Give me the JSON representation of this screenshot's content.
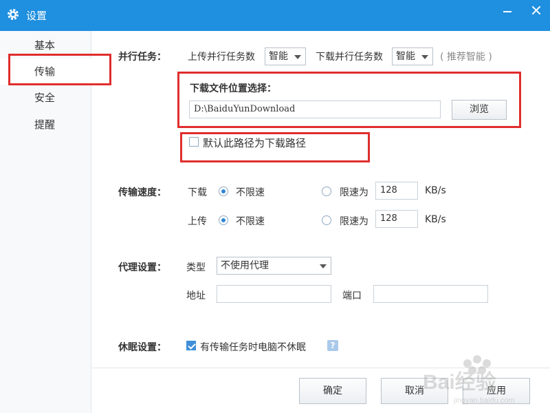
{
  "window": {
    "title": "设置"
  },
  "sidebar": {
    "items": [
      {
        "label": "基本"
      },
      {
        "label": "传输"
      },
      {
        "label": "安全"
      },
      {
        "label": "提醒"
      }
    ]
  },
  "parallel": {
    "label": "并行任务：",
    "upload_label": "上传并行任务数",
    "upload_value": "智能",
    "download_label": "下载并行任务数",
    "download_value": "智能",
    "hint": "( 推荐智能 )"
  },
  "download_location": {
    "label": "下载文件位置选择：",
    "path": "D:\\BaiduYunDownload",
    "browse_label": "浏览",
    "default_checkbox_label": "默认此路径为下载路径",
    "default_checked": false
  },
  "speed": {
    "label": "传输速度：",
    "download_label": "下载",
    "upload_label": "上传",
    "unlimited_label": "不限速",
    "limit_label": "限速为",
    "download_limit_value": "128",
    "upload_limit_value": "128",
    "unit": "KB/s"
  },
  "proxy": {
    "label": "代理设置：",
    "type_label": "类型",
    "type_value": "不使用代理",
    "address_label": "地址",
    "port_label": "端口",
    "address_value": "",
    "port_value": ""
  },
  "sleep": {
    "label": "休眠设置：",
    "checkbox_label": "有传输任务时电脑不休眠",
    "checked": true,
    "help": "?"
  },
  "footer": {
    "ok_label": "确定",
    "cancel_label": "取消",
    "apply_label": "应用"
  },
  "watermark": {
    "text": "Bai经验",
    "url": "jingyan.baidu.com"
  },
  "colors": {
    "titlebar": "#1f8fdf",
    "highlight": "#e02d2d",
    "accent": "#2f86d6"
  }
}
